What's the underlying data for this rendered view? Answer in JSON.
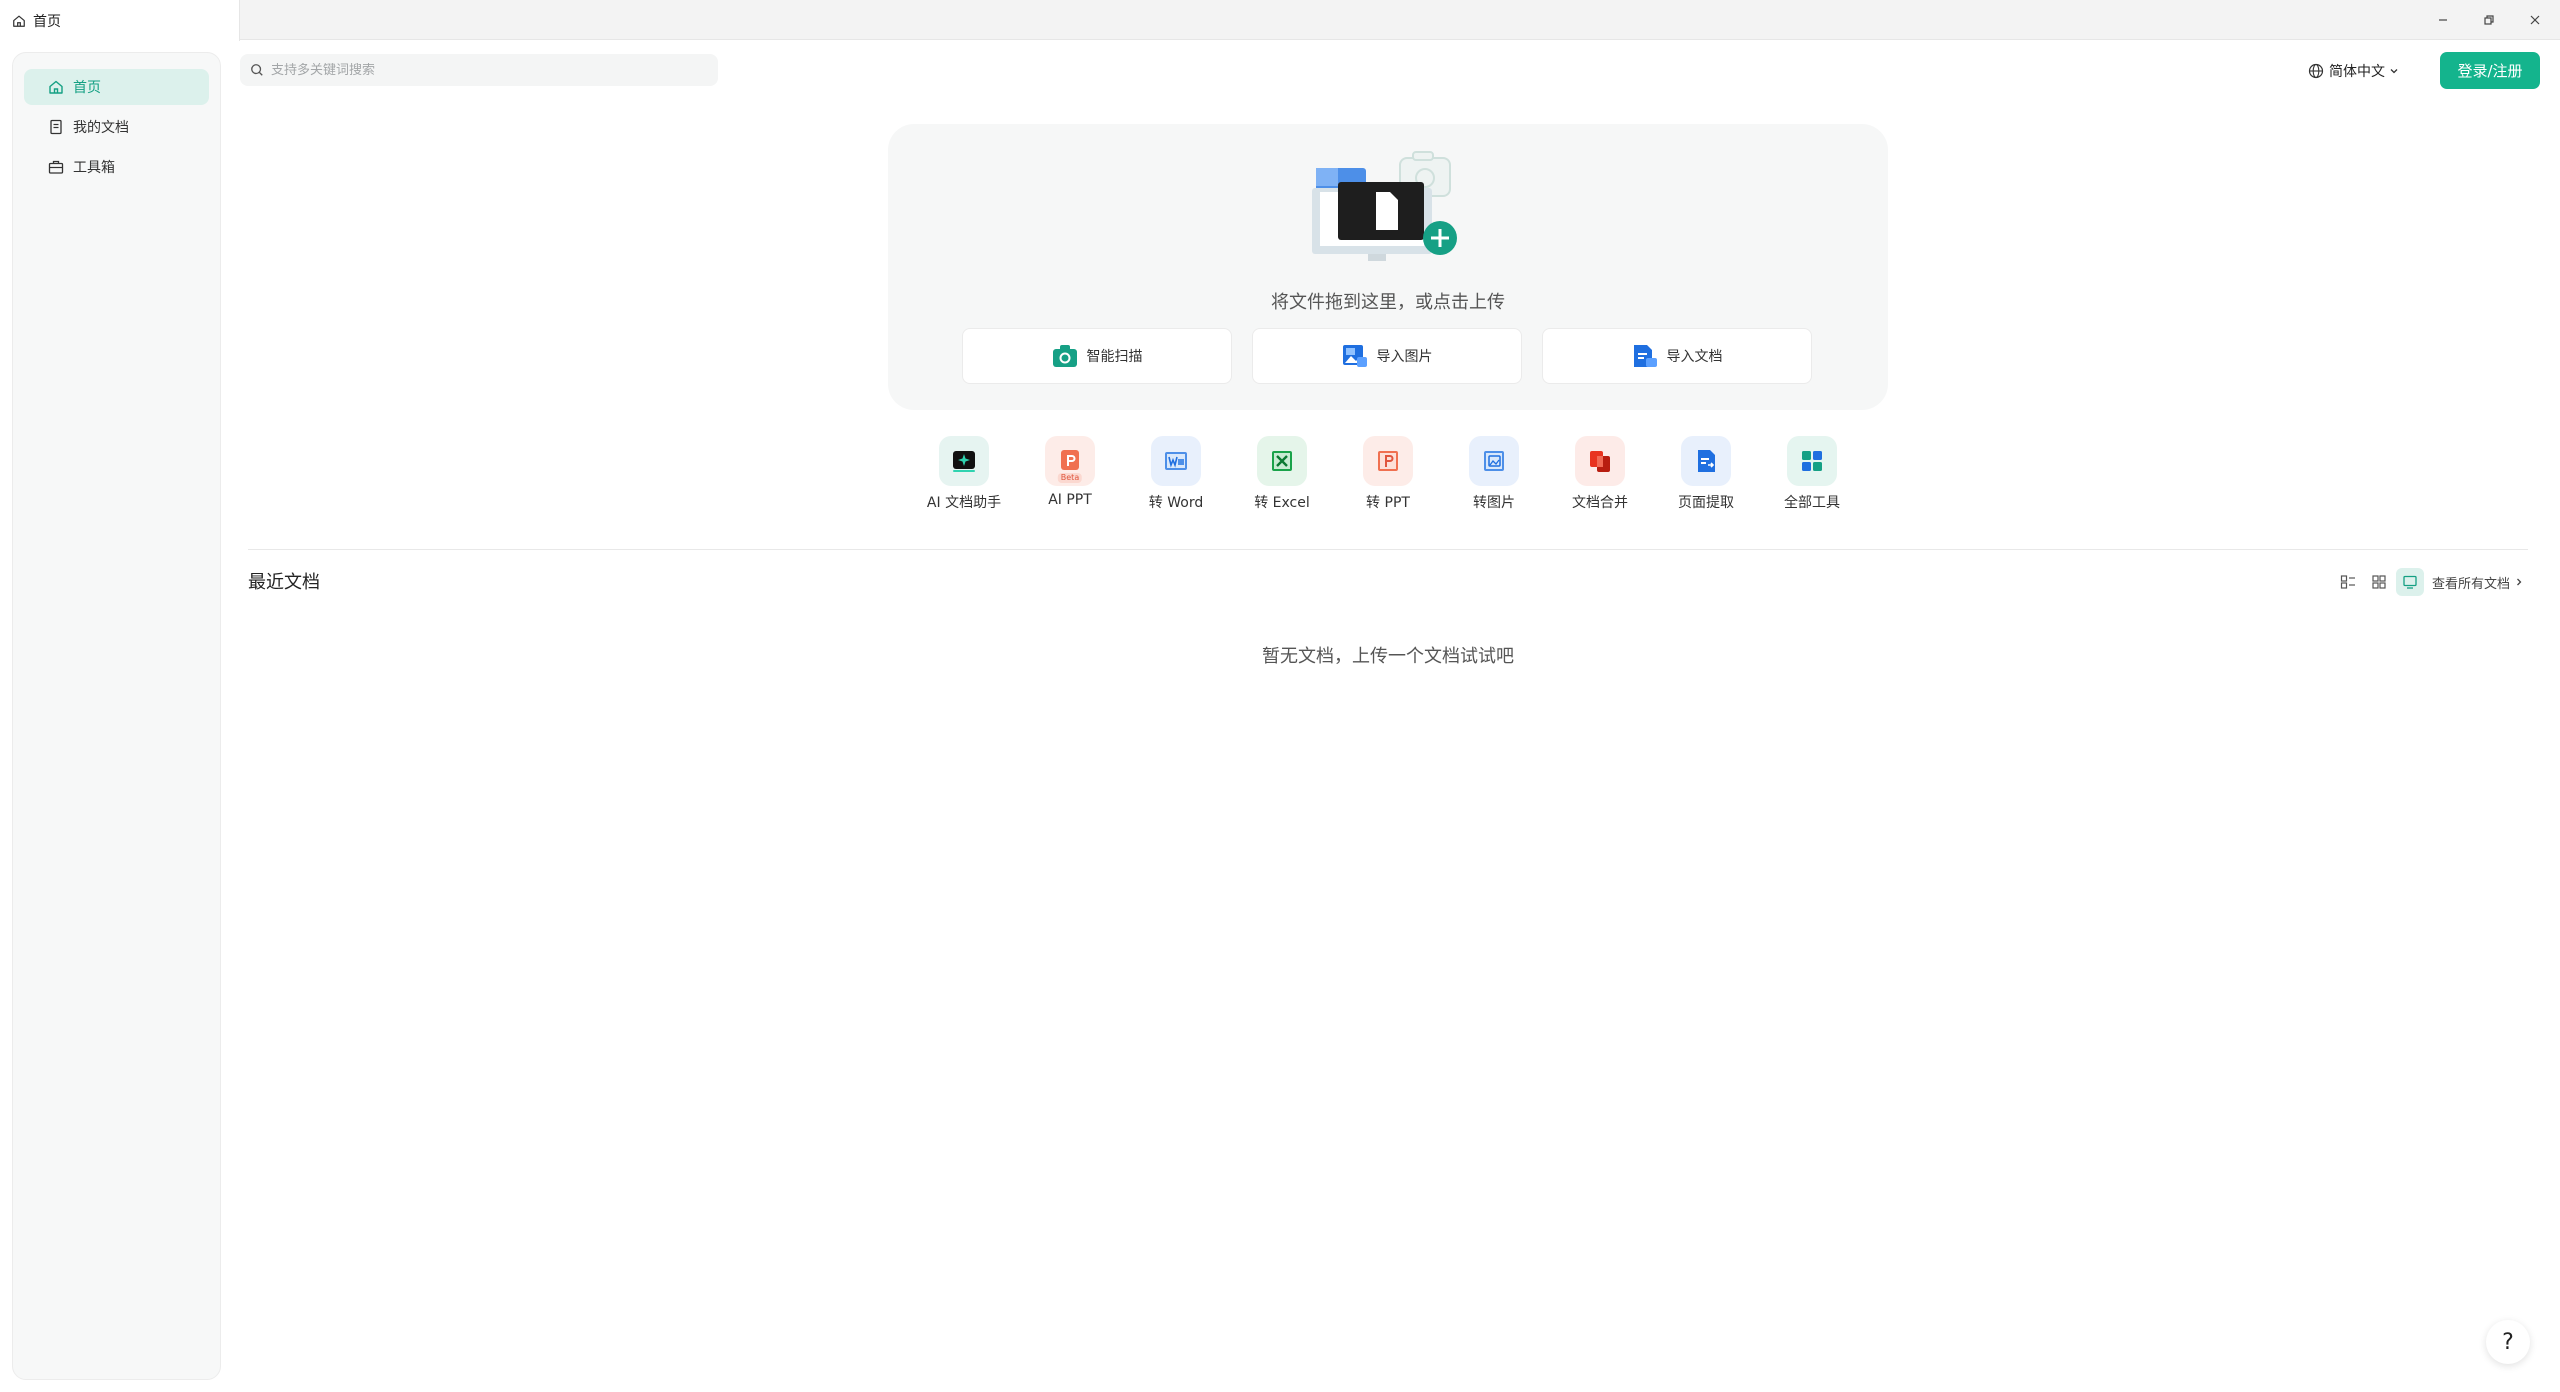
{
  "window": {
    "tab_label": "首页"
  },
  "sidebar": {
    "items": [
      {
        "label": "首页",
        "icon": "home-icon",
        "active": true
      },
      {
        "label": "我的文档",
        "icon": "document-icon",
        "active": false
      },
      {
        "label": "工具箱",
        "icon": "toolbox-icon",
        "active": false
      }
    ]
  },
  "search": {
    "placeholder": "支持多关键词搜索",
    "value": ""
  },
  "header": {
    "language": "简体中文",
    "login_label": "登录/注册"
  },
  "upload": {
    "hint": "将文件拖到这里，或点击上传",
    "buttons": [
      {
        "label": "智能扫描",
        "icon": "camera-icon"
      },
      {
        "label": "导入图片",
        "icon": "image-icon"
      },
      {
        "label": "导入文档",
        "icon": "document-import-icon"
      }
    ]
  },
  "tools": [
    {
      "label": "AI 文档助手",
      "icon": "ai-assistant-icon"
    },
    {
      "label": "AI PPT",
      "icon": "ai-ppt-icon",
      "badge": "Beta"
    },
    {
      "label": "转 Word",
      "icon": "word-icon"
    },
    {
      "label": "转 Excel",
      "icon": "excel-icon"
    },
    {
      "label": "转 PPT",
      "icon": "ppt-icon"
    },
    {
      "label": "转图片",
      "icon": "to-image-icon"
    },
    {
      "label": "文档合并",
      "icon": "merge-icon"
    },
    {
      "label": "页面提取",
      "icon": "extract-icon"
    },
    {
      "label": "全部工具",
      "icon": "all-tools-icon"
    }
  ],
  "recent": {
    "title": "最近文档",
    "view_all_label": "查看所有文档",
    "empty_text": "暂无文档，上传一个文档试试吧"
  },
  "help": {
    "label": "?"
  },
  "colors": {
    "accent": "#14b48d",
    "active_bg": "#dcf1ec"
  }
}
